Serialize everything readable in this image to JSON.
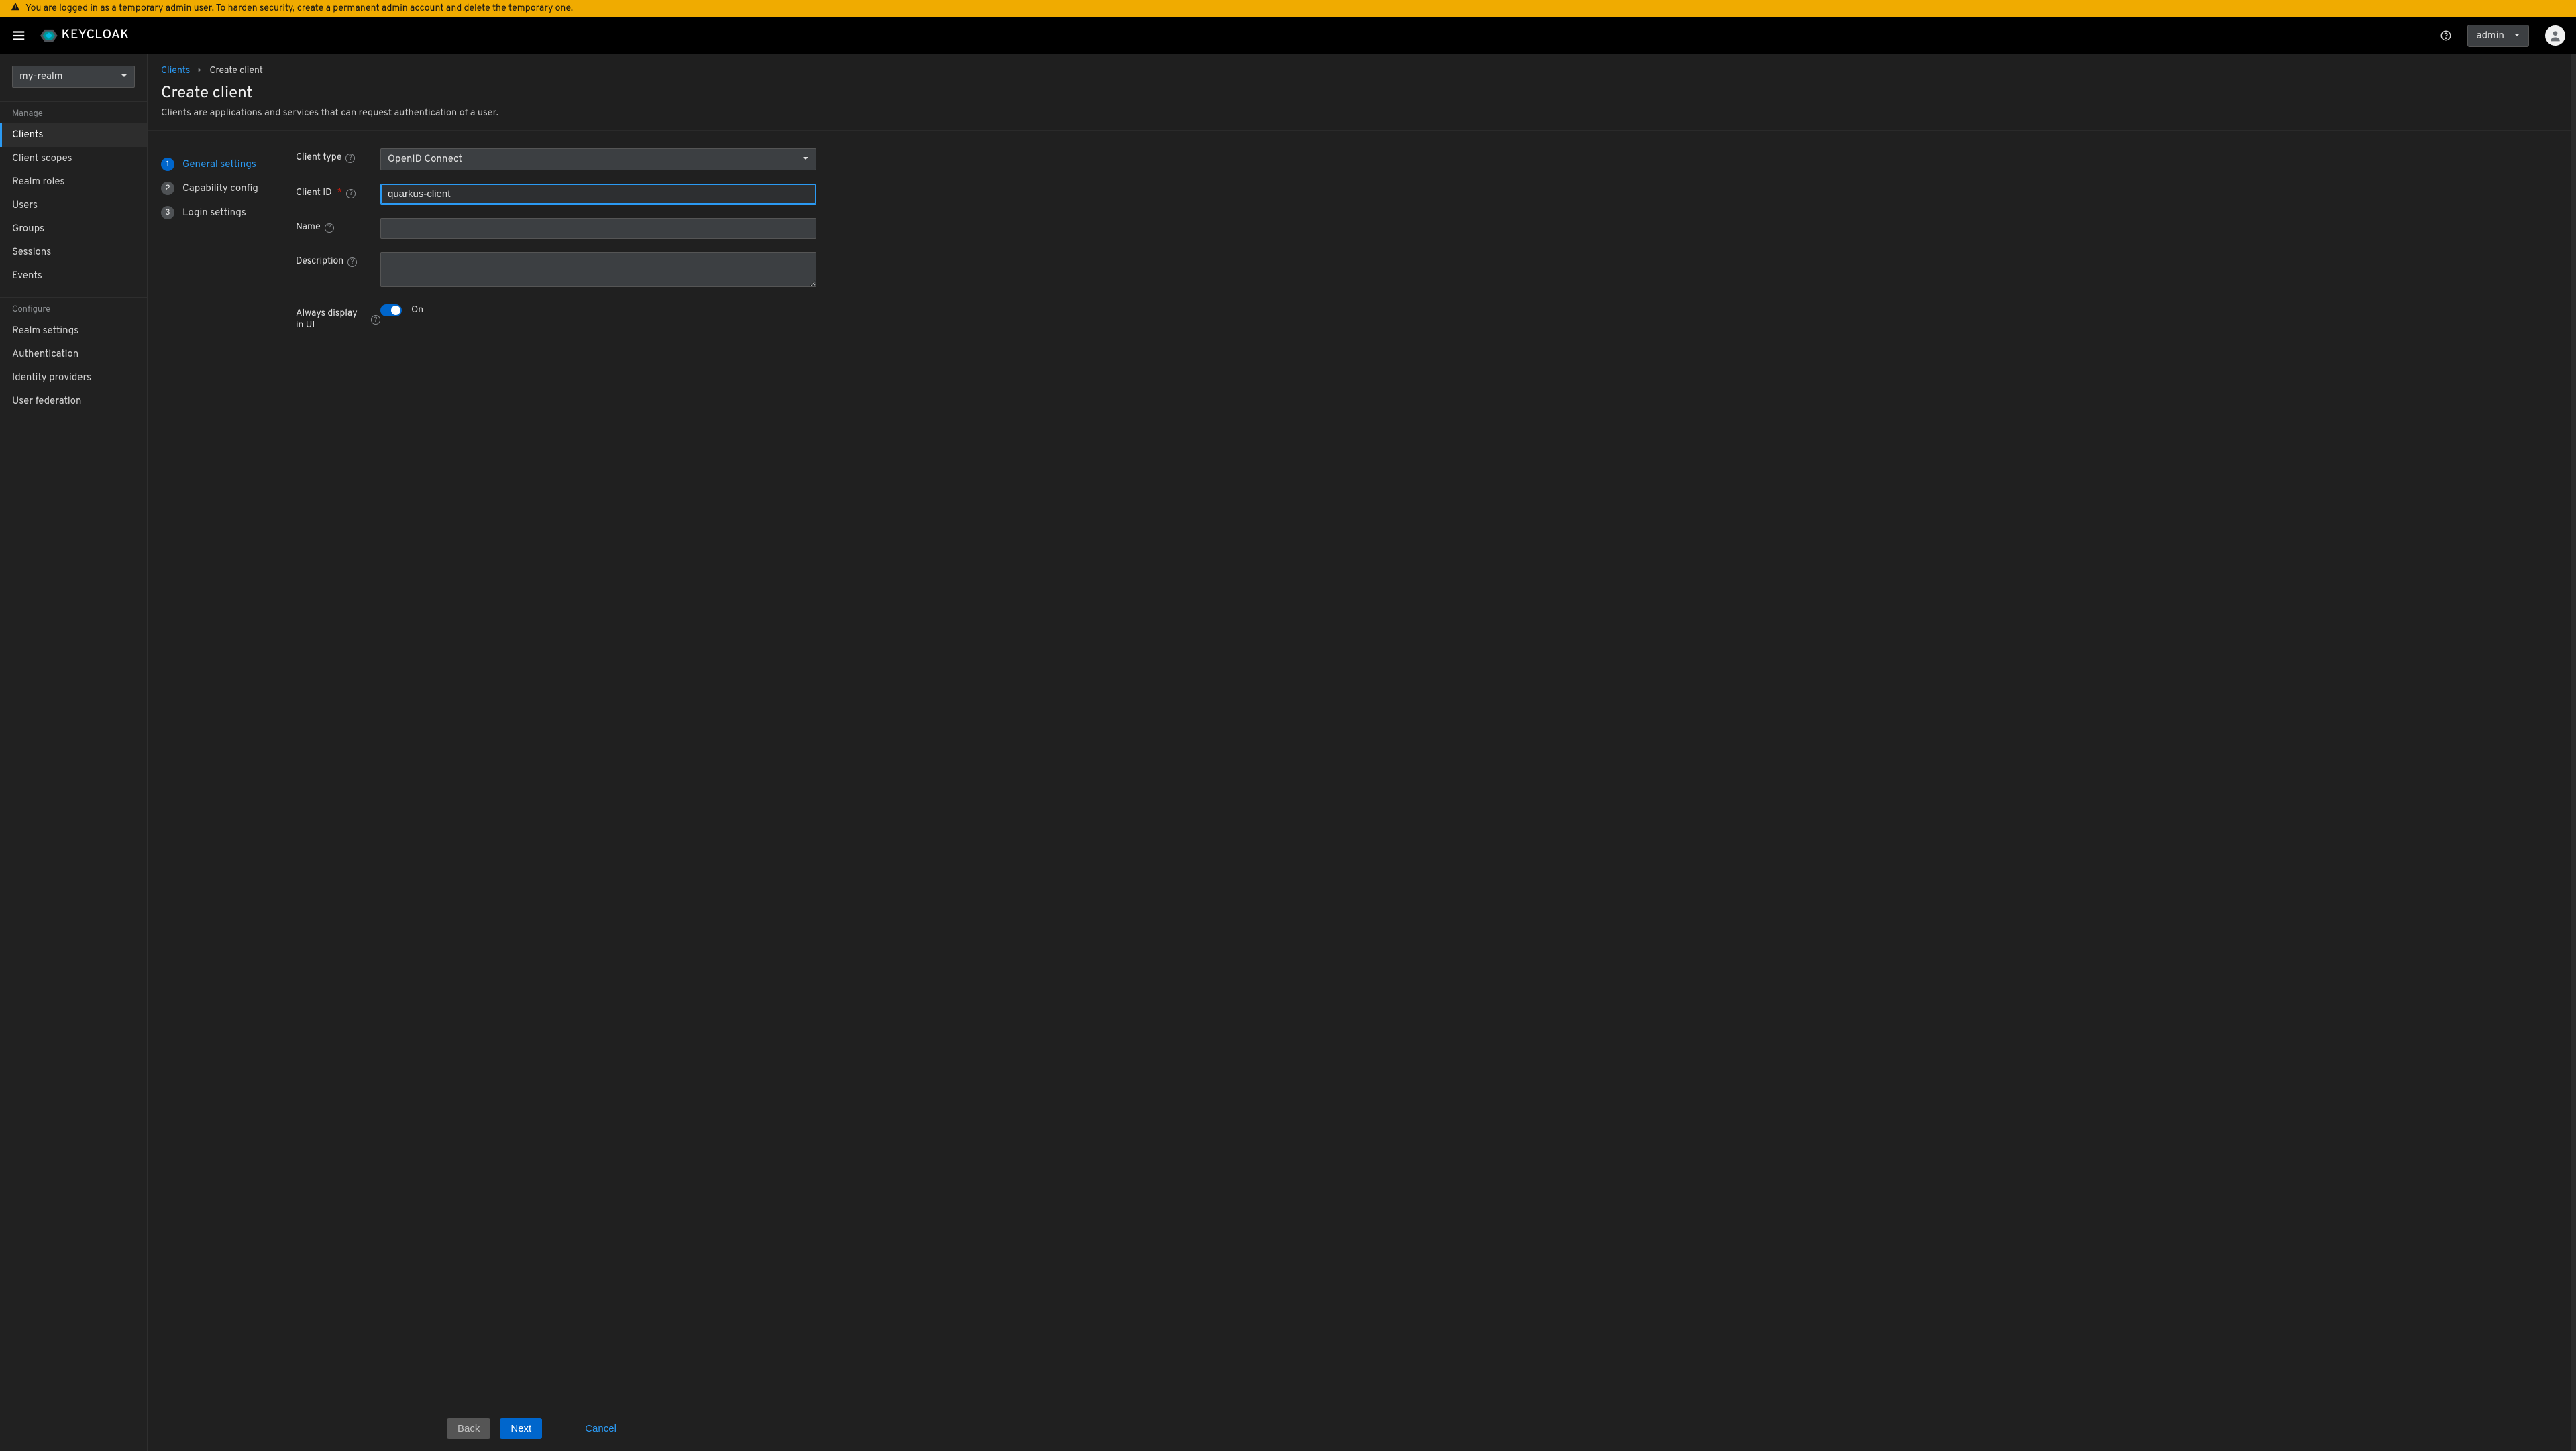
{
  "warning": "You are logged in as a temporary admin user. To harden security, create a permanent admin account and delete the temporary one.",
  "header": {
    "brand": "KEYCLOAK",
    "user_label": "admin"
  },
  "sidebar": {
    "realm_selected": "my-realm",
    "sections": [
      {
        "title": "Manage",
        "items": [
          "Clients",
          "Client scopes",
          "Realm roles",
          "Users",
          "Groups",
          "Sessions",
          "Events"
        ],
        "active_index": 0
      },
      {
        "title": "Configure",
        "items": [
          "Realm settings",
          "Authentication",
          "Identity providers",
          "User federation"
        ],
        "active_index": -1
      }
    ]
  },
  "breadcrumb": {
    "root": "Clients",
    "current": "Create client"
  },
  "page": {
    "title": "Create client",
    "subtitle": "Clients are applications and services that can request authentication of a user."
  },
  "wizard": {
    "steps": [
      "General settings",
      "Capability config",
      "Login settings"
    ],
    "active_index": 0
  },
  "form": {
    "client_type_label": "Client type",
    "client_type_value": "OpenID Connect",
    "client_id_label": "Client ID",
    "client_id_value": "quarkus-client",
    "name_label": "Name",
    "name_value": "",
    "description_label": "Description",
    "description_value": "",
    "always_display_label": "Always display in UI",
    "always_display_state_label": "On"
  },
  "footer": {
    "back": "Back",
    "next": "Next",
    "cancel": "Cancel"
  }
}
